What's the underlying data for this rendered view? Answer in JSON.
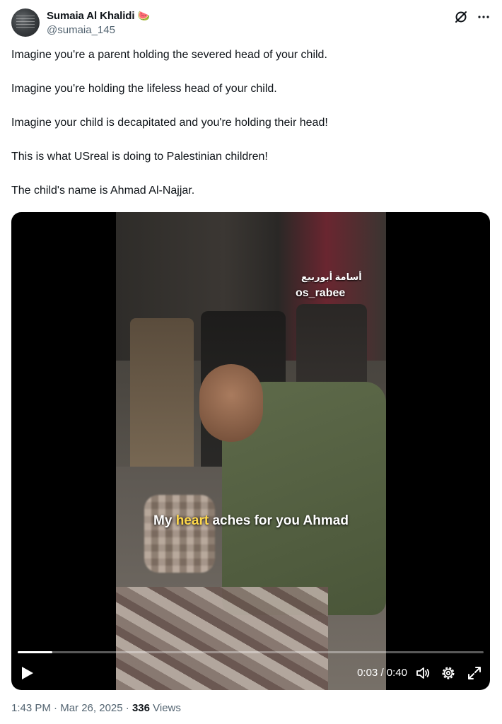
{
  "author": {
    "display_name": "Sumaia Al Khalidi",
    "emoji": "🍉",
    "handle": "@sumaia_145"
  },
  "tweet": {
    "paragraphs": [
      "Imagine you're a parent holding the severed head of your child.",
      "Imagine you're holding the lifeless head of your child.",
      "Imagine your child is decapitated and you're holding their head!",
      "This is what USreal is doing to Palestinian children!",
      "The child's name is Ahmad Al-Najjar."
    ]
  },
  "video": {
    "watermark_arabic": "أسامة أبوربيع",
    "watermark": "os_rabee",
    "caption_before": "My ",
    "caption_highlight": "heart",
    "caption_after": " aches for you Ahmad",
    "current_time": "0:03",
    "separator": " / ",
    "duration": "0:40",
    "progress": 0.075
  },
  "meta": {
    "time": "1:43 PM",
    "dot1": " · ",
    "date": "Mar 26, 2025",
    "dot2": " · ",
    "views_count": "336",
    "views_label": " Views"
  },
  "icons": {
    "grok": "grok-icon",
    "more": "more-icon",
    "play": "play-icon",
    "volume": "volume-icon",
    "settings": "gear-icon",
    "fullscreen": "fullscreen-icon"
  },
  "colors": {
    "text": "#0f1419",
    "secondary": "#536471",
    "caption_highlight": "#ffd84a"
  }
}
